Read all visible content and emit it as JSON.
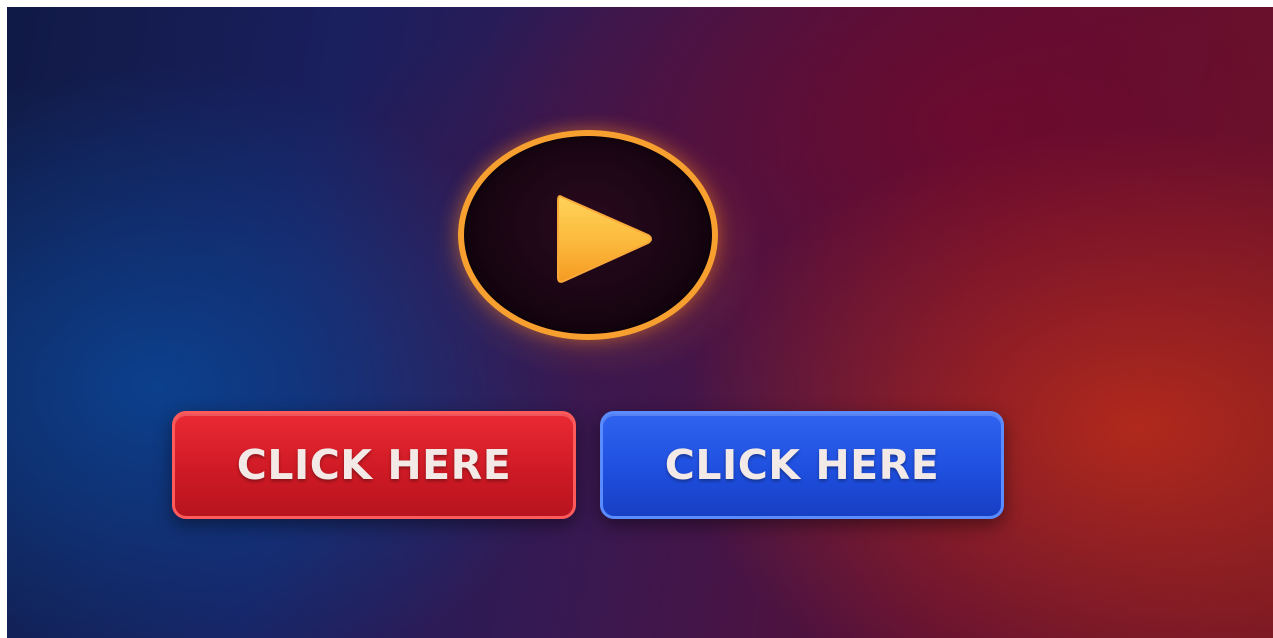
{
  "play": {
    "icon": "play-icon",
    "ring_color": "#f7a030",
    "triangle_color": "#fbb93b"
  },
  "buttons": [
    {
      "label": "CLICK HERE",
      "color": "#d81e29"
    },
    {
      "label": "CLICK HERE",
      "color": "#2456e6"
    }
  ]
}
